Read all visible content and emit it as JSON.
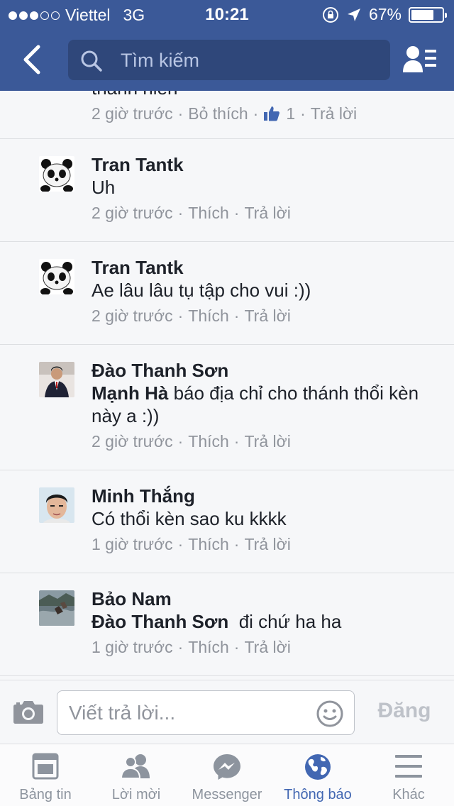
{
  "status_bar": {
    "carrier": "Viettel",
    "network": "3G",
    "time": "10:21",
    "battery": "67%",
    "battery_level": 0.67
  },
  "header": {
    "search_placeholder": "Tìm kiếm",
    "bar_color": "#3b5998"
  },
  "comments": [
    {
      "name": "",
      "text_partial": "thánh hiền",
      "time": "2 giờ trước",
      "like_action": "Bỏ thích",
      "like_count": "1",
      "reply": "Trả lời"
    },
    {
      "name": "Tran Tantk",
      "text": "Uh",
      "time": "2 giờ trước",
      "like_action": "Thích",
      "reply": "Trả lời"
    },
    {
      "name": "Tran Tantk",
      "text": "Ae lâu lâu tụ tập cho vui :))",
      "time": "2 giờ trước",
      "like_action": "Thích",
      "reply": "Trả lời"
    },
    {
      "name": "Đào Thanh Sơn",
      "mention": "Mạnh Hà",
      "text": " báo địa chỉ cho thánh thổi kèn này a :))",
      "time": "2 giờ trước",
      "like_action": "Thích",
      "reply": "Trả lời"
    },
    {
      "name": "Minh Thắng",
      "text": "Có thổi kèn sao ku kkkk",
      "time": "1 giờ trước",
      "like_action": "Thích",
      "reply": "Trả lời"
    },
    {
      "name": "Bảo Nam",
      "mention": "Đào Thanh Sơn",
      "text": "  đi chứ ha ha",
      "time": "1 giờ trước",
      "like_action": "Thích",
      "reply": "Trả lời"
    }
  ],
  "reply_bar": {
    "placeholder": "Viết trả lời...",
    "post_label": "Đăng"
  },
  "tabs": [
    {
      "label": "Bảng tin",
      "icon": "news-feed-icon"
    },
    {
      "label": "Lời mời",
      "icon": "friend-requests-icon"
    },
    {
      "label": "Messenger",
      "icon": "messenger-icon"
    },
    {
      "label": "Thông báo",
      "icon": "globe-icon",
      "active": true
    },
    {
      "label": "Khác",
      "icon": "menu-icon"
    }
  ],
  "colors": {
    "accent": "#4267b2",
    "meta_text": "#90949c",
    "like_blue": "#4267b2"
  }
}
